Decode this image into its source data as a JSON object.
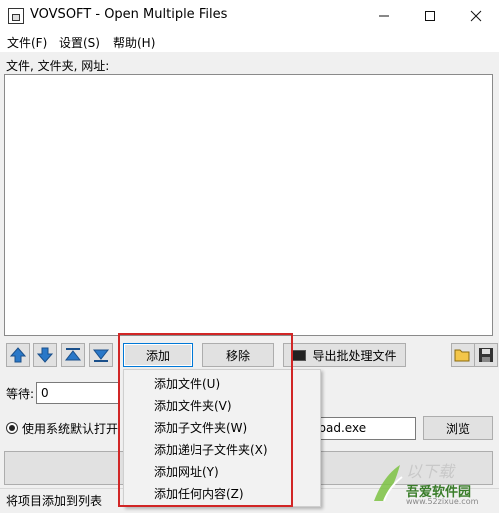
{
  "window": {
    "title": "VOVSOFT - Open Multiple Files"
  },
  "menu": {
    "file": "文件(F)",
    "settings": "设置(S)",
    "help": "帮助(H)"
  },
  "list": {
    "label": "文件, 文件夹, 网址:"
  },
  "buttons": {
    "add": "添加",
    "remove": "移除",
    "export": "导出批处理文件",
    "browse": "浏览"
  },
  "wait": {
    "label": "等待:",
    "value": "0"
  },
  "open_with": {
    "label": "使用系统默认打开",
    "exe_value": "epad.exe"
  },
  "dropdown": {
    "items": [
      "添加文件(U)",
      "添加文件夹(V)",
      "添加子文件夹(W)",
      "添加递归子文件夹(X)",
      "添加网址(Y)",
      "添加任何内容(Z)"
    ]
  },
  "status": {
    "text": "将项目添加到列表"
  },
  "watermark": {
    "text": "吾爱软件园",
    "url": "www.52zixue.com"
  },
  "colors": {
    "highlight": "#d12626",
    "focus": "#0078d7",
    "arrow_blue": "#2a78c8"
  }
}
